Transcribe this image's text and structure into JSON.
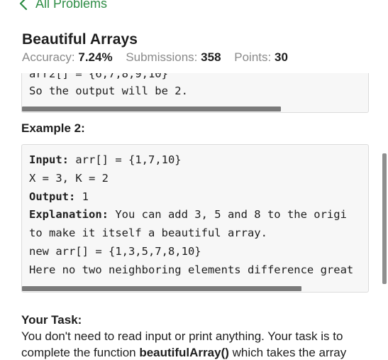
{
  "nav": {
    "back_label": "All Problems"
  },
  "problem": {
    "title": "Beautiful Arrays",
    "accuracy_label": "Accuracy:",
    "accuracy_value": "7.24%",
    "submissions_label": "Submissions:",
    "submissions_value": "358",
    "points_label": "Points:",
    "points_value": "30"
  },
  "example1_tail": {
    "partial_line": "arr2[] = {6,7,8,9,10}",
    "output_line": "So the output will be 2."
  },
  "example2": {
    "heading": "Example 2:",
    "input_label": "Input:",
    "input_value": " arr[] = {1,7,10}",
    "params_line": "X = 3, K = 2",
    "output_label": "Output:",
    "output_value": " 1",
    "explanation_label": "Explanation:",
    "explanation_value": " You can add 3, 5 and 8 to the origi",
    "explanation_cont": "to make it itself a beautiful array.",
    "new_arr_line": "new arr[] = {1,3,5,7,8,10}",
    "note_line": "Here no two neighboring elements difference great"
  },
  "your_task": {
    "heading": "Your Task:",
    "line1": "You don't need to read input or print anything. Your task is to",
    "line2_prefix": "complete the function ",
    "line2_function": "beautifulArray()",
    "line2_suffix": " which takes the array"
  },
  "colors": {
    "accent": "#2f8d46"
  }
}
